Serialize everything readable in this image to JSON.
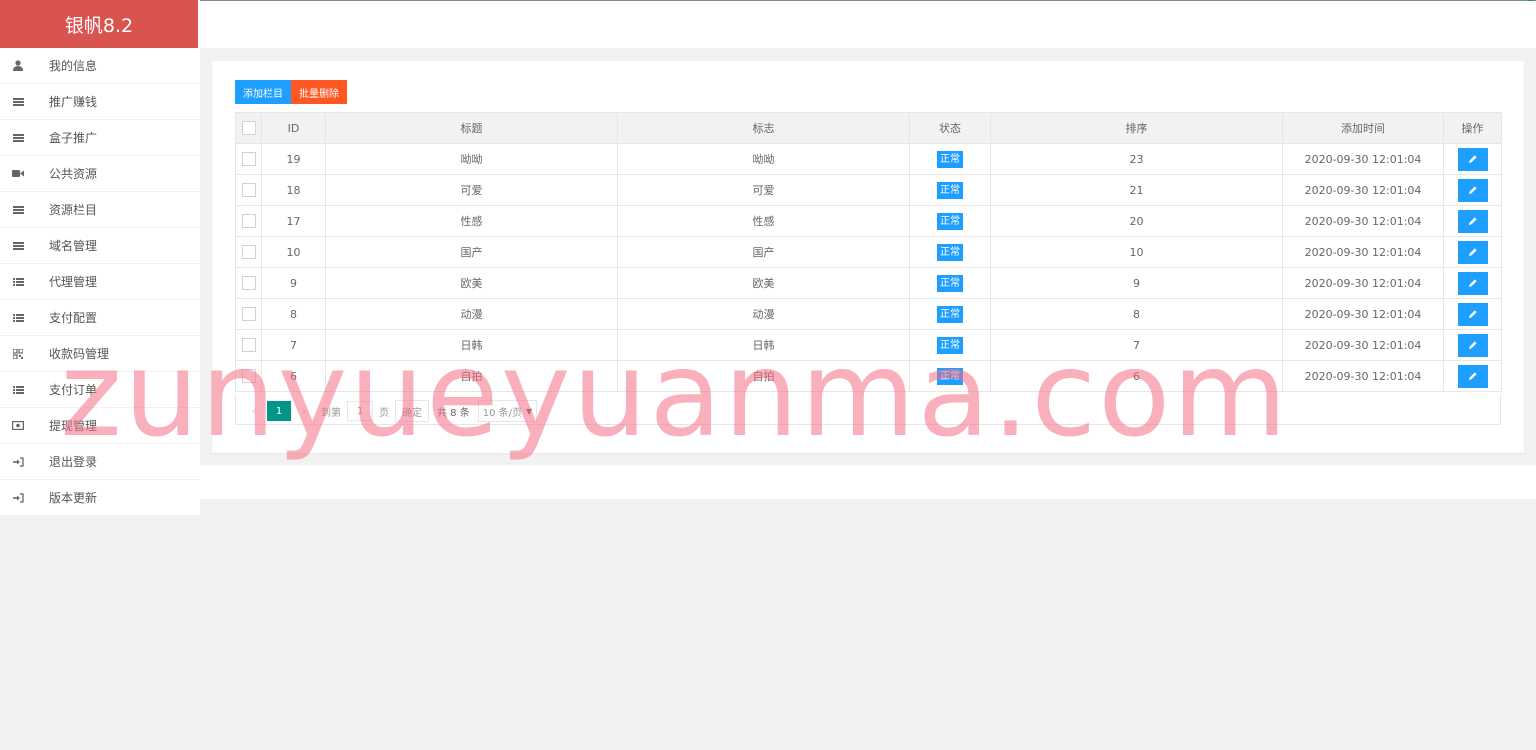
{
  "brand": {
    "title": "银帆8.2"
  },
  "sidebar": {
    "items": [
      {
        "label": "我的信息",
        "icon": "user-icon"
      },
      {
        "label": "推广赚钱",
        "icon": "list-icon"
      },
      {
        "label": "盒子推广",
        "icon": "list-icon"
      },
      {
        "label": "公共资源",
        "icon": "video-icon"
      },
      {
        "label": "资源栏目",
        "icon": "list-icon"
      },
      {
        "label": "域名管理",
        "icon": "list-icon"
      },
      {
        "label": "代理管理",
        "icon": "bulleted-list-icon"
      },
      {
        "label": "支付配置",
        "icon": "bulleted-list-icon"
      },
      {
        "label": "收款码管理",
        "icon": "qrcode-icon"
      },
      {
        "label": "支付订单",
        "icon": "bulleted-list-icon"
      },
      {
        "label": "提现管理",
        "icon": "money-icon"
      },
      {
        "label": "退出登录",
        "icon": "sign-in-icon"
      },
      {
        "label": "版本更新",
        "icon": "sign-in-icon"
      }
    ]
  },
  "toolbar": {
    "add_label": "添加栏目",
    "batch_delete_label": "批量删除"
  },
  "table": {
    "headers": {
      "id": "ID",
      "title": "标题",
      "sign": "标志",
      "status": "状态",
      "sort": "排序",
      "time": "添加时间",
      "action": "操作"
    },
    "rows": [
      {
        "id": "19",
        "title": "呦呦",
        "sign": "呦呦",
        "status": "正常",
        "sort": "23",
        "time": "2020-09-30 12:01:04"
      },
      {
        "id": "18",
        "title": "可爱",
        "sign": "可爱",
        "status": "正常",
        "sort": "21",
        "time": "2020-09-30 12:01:04"
      },
      {
        "id": "17",
        "title": "性感",
        "sign": "性感",
        "status": "正常",
        "sort": "20",
        "time": "2020-09-30 12:01:04"
      },
      {
        "id": "10",
        "title": "国产",
        "sign": "国产",
        "status": "正常",
        "sort": "10",
        "time": "2020-09-30 12:01:04"
      },
      {
        "id": "9",
        "title": "欧美",
        "sign": "欧美",
        "status": "正常",
        "sort": "9",
        "time": "2020-09-30 12:01:04"
      },
      {
        "id": "8",
        "title": "动漫",
        "sign": "动漫",
        "status": "正常",
        "sort": "8",
        "time": "2020-09-30 12:01:04"
      },
      {
        "id": "7",
        "title": "日韩",
        "sign": "日韩",
        "status": "正常",
        "sort": "7",
        "time": "2020-09-30 12:01:04"
      },
      {
        "id": "6",
        "title": "自拍",
        "sign": "自拍",
        "status": "正常",
        "sort": "6",
        "time": "2020-09-30 12:01:04"
      }
    ]
  },
  "pager": {
    "current": "1",
    "goto_label": "到第",
    "page_input": "1",
    "page_unit": "页",
    "confirm_label": "确定",
    "total": "共 8 条",
    "page_size": "10 条/页"
  },
  "watermark": "zunyueyuanma.com",
  "colors": {
    "brand": "#d9534f",
    "primary": "#1e9fff",
    "danger": "#ff5722",
    "pager_current": "#009688"
  }
}
